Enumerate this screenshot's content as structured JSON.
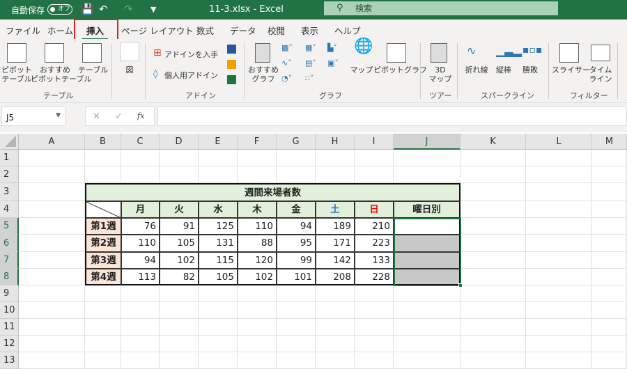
{
  "titlebar": {
    "autosave": "自動保存",
    "toggle": "オフ",
    "filename": "11-3.xlsx  -  Excel",
    "search_placeholder": "検索"
  },
  "tabs": [
    "ファイル",
    "ホーム",
    "挿入",
    "ページ レイアウト",
    "数式",
    "データ",
    "校閲",
    "表示",
    "ヘルプ"
  ],
  "active_tab": "挿入",
  "ribbon": {
    "pivot": "ピボット\nテーブル",
    "rec_pivot": "おすすめ\nピボットテーブル",
    "table": "テーブル",
    "group_table": "テーブル",
    "figure": "図",
    "get_addin": "アドインを入手",
    "my_addin": "個人用アドイン",
    "group_addin": "アドイン",
    "rec_chart": "おすすめ\nグラフ",
    "map": "マップ",
    "pivot_chart": "ピボットグラフ",
    "group_chart": "グラフ",
    "map3d": "3D\nマップ",
    "group_tour": "ツアー",
    "line": "折れ線",
    "column": "縦棒",
    "winloss": "勝敗",
    "group_sparkline": "スパークライン",
    "slicer": "スライサー",
    "timeline": "タイム\nライン",
    "group_filter": "フィルター"
  },
  "formula_bar": {
    "name_box": "J5",
    "fx": "fx",
    "value": ""
  },
  "sheet": {
    "columns": [
      "A",
      "B",
      "C",
      "D",
      "E",
      "F",
      "G",
      "H",
      "I",
      "J",
      "K",
      "L",
      "M"
    ],
    "rows": [
      "1",
      "2",
      "3",
      "4",
      "5",
      "6",
      "7",
      "8",
      "9",
      "10",
      "11",
      "12",
      "13"
    ],
    "selected_column": "J",
    "selected_rows": [
      "5",
      "6",
      "7",
      "8"
    ],
    "table_title": "週間来場者数",
    "days": [
      "月",
      "火",
      "水",
      "木",
      "金",
      "土",
      "日"
    ],
    "extra_header": "曜日別",
    "weeks": [
      "第1週",
      "第2週",
      "第3週",
      "第4週"
    ],
    "values": [
      [
        76,
        91,
        125,
        110,
        94,
        189,
        210
      ],
      [
        110,
        105,
        131,
        88,
        95,
        171,
        223
      ],
      [
        94,
        102,
        115,
        120,
        99,
        142,
        133
      ],
      [
        113,
        82,
        105,
        102,
        101,
        208,
        228
      ]
    ],
    "colors": {
      "saturday": "#2f75b5",
      "sunday": "#ff0000",
      "header_bg": "#e2efda",
      "week_bg": "#fce4d6",
      "selected_fill": "#c8c8c8",
      "accent": "#217346"
    }
  }
}
